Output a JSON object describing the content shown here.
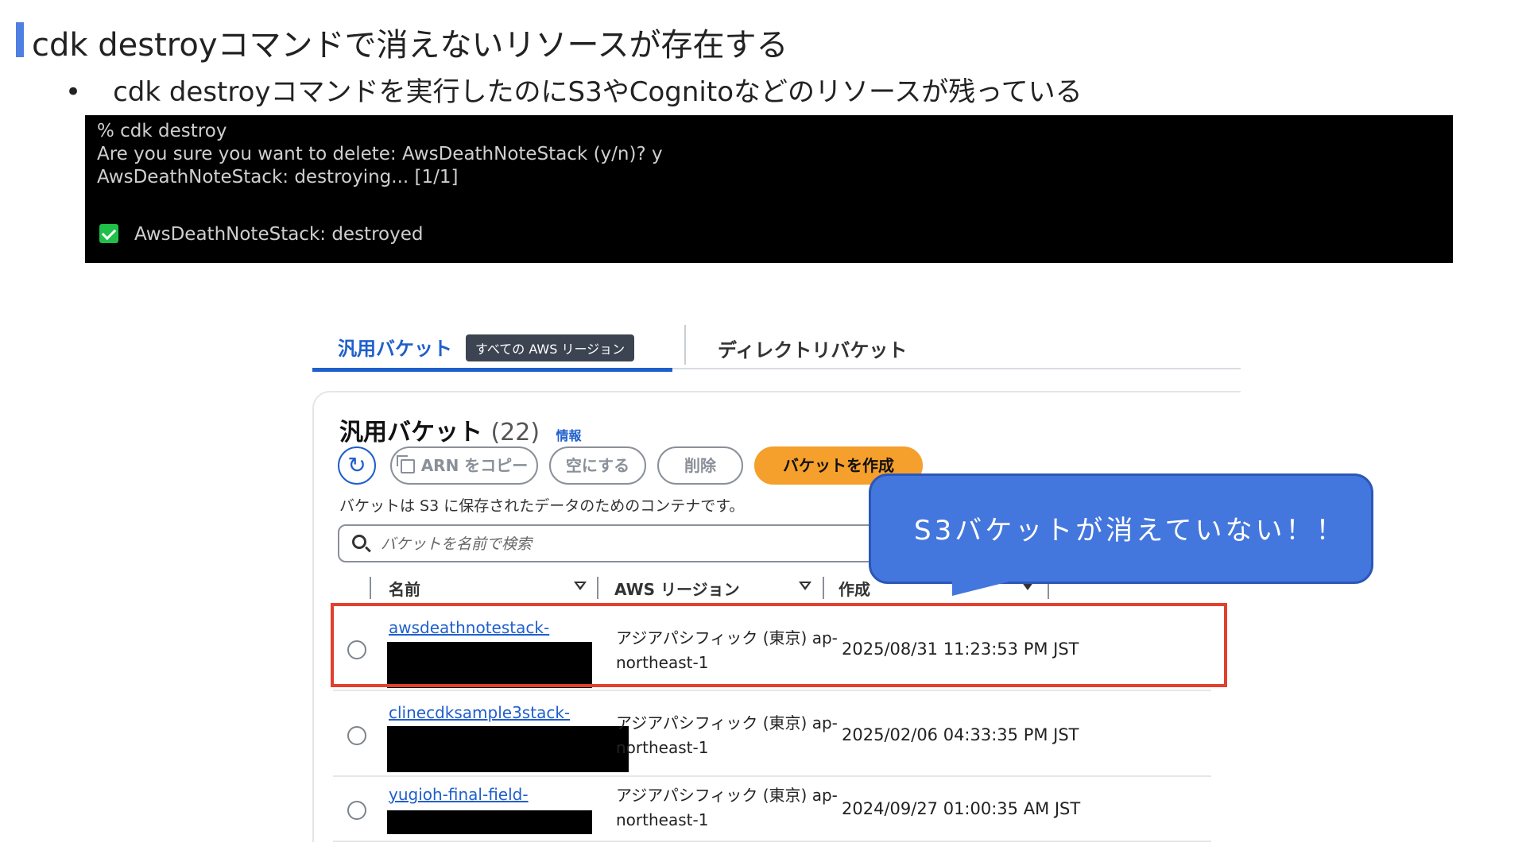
{
  "slide": {
    "title": "cdk destroyコマンドで消えないリソースが存在する",
    "bullet_symbol": "•",
    "bullet": "cdk destroyコマンドを実行したのにS3やCognitoなどのリソースが残っている"
  },
  "terminal": {
    "lines": [
      "% cdk destroy",
      "Are you sure you want to delete: AwsDeathNoteStack (y/n)? y",
      "AwsDeathNoteStack: destroying... [1/1]"
    ],
    "result": "AwsDeathNoteStack: destroyed"
  },
  "console": {
    "tabs": {
      "active_label": "汎用バケット",
      "badge": "すべての AWS リージョン",
      "other_label": "ディレクトリバケット"
    },
    "card": {
      "title": "汎用バケット",
      "count": "(22)",
      "info": "情報",
      "description": "バケットは S3 に保存されたデータのためのコンテナです。"
    },
    "buttons": {
      "refresh_icon": "↻",
      "copy_arn": "ARN をコピー",
      "empty": "空にする",
      "delete": "削除",
      "create": "バケットを作成"
    },
    "search": {
      "placeholder": "バケットを名前で検索"
    },
    "columns": {
      "name": "名前",
      "region": "AWS リージョン",
      "created": "作成"
    },
    "rows": [
      {
        "name": "awsdeathnotestack-",
        "region_line1": "アジアパシフィック (東京) ap-",
        "region_line2": "northeast-1",
        "created": "2025/08/31 11:23:53 PM JST"
      },
      {
        "name": "clinecdksample3stack-",
        "region_line1": "アジアパシフィック (東京) ap-",
        "region_line2": "northeast-1",
        "created": "2025/02/06 04:33:35 PM JST"
      },
      {
        "name": "yugioh-final-field-",
        "region_line1": "アジアパシフィック (東京) ap-",
        "region_line2": "northeast-1",
        "created": "2024/09/27 01:00:35 AM JST"
      }
    ]
  },
  "callout": {
    "text": "S3バケットが消えていない！！"
  },
  "colors": {
    "accent_bar": "#4f7fe0",
    "aws_link": "#1f5fcc",
    "primary_button": "#f59f2c",
    "highlight_border": "#e2402e",
    "callout_fill": "#4477dd",
    "terminal_check": "#1fbf4a"
  }
}
